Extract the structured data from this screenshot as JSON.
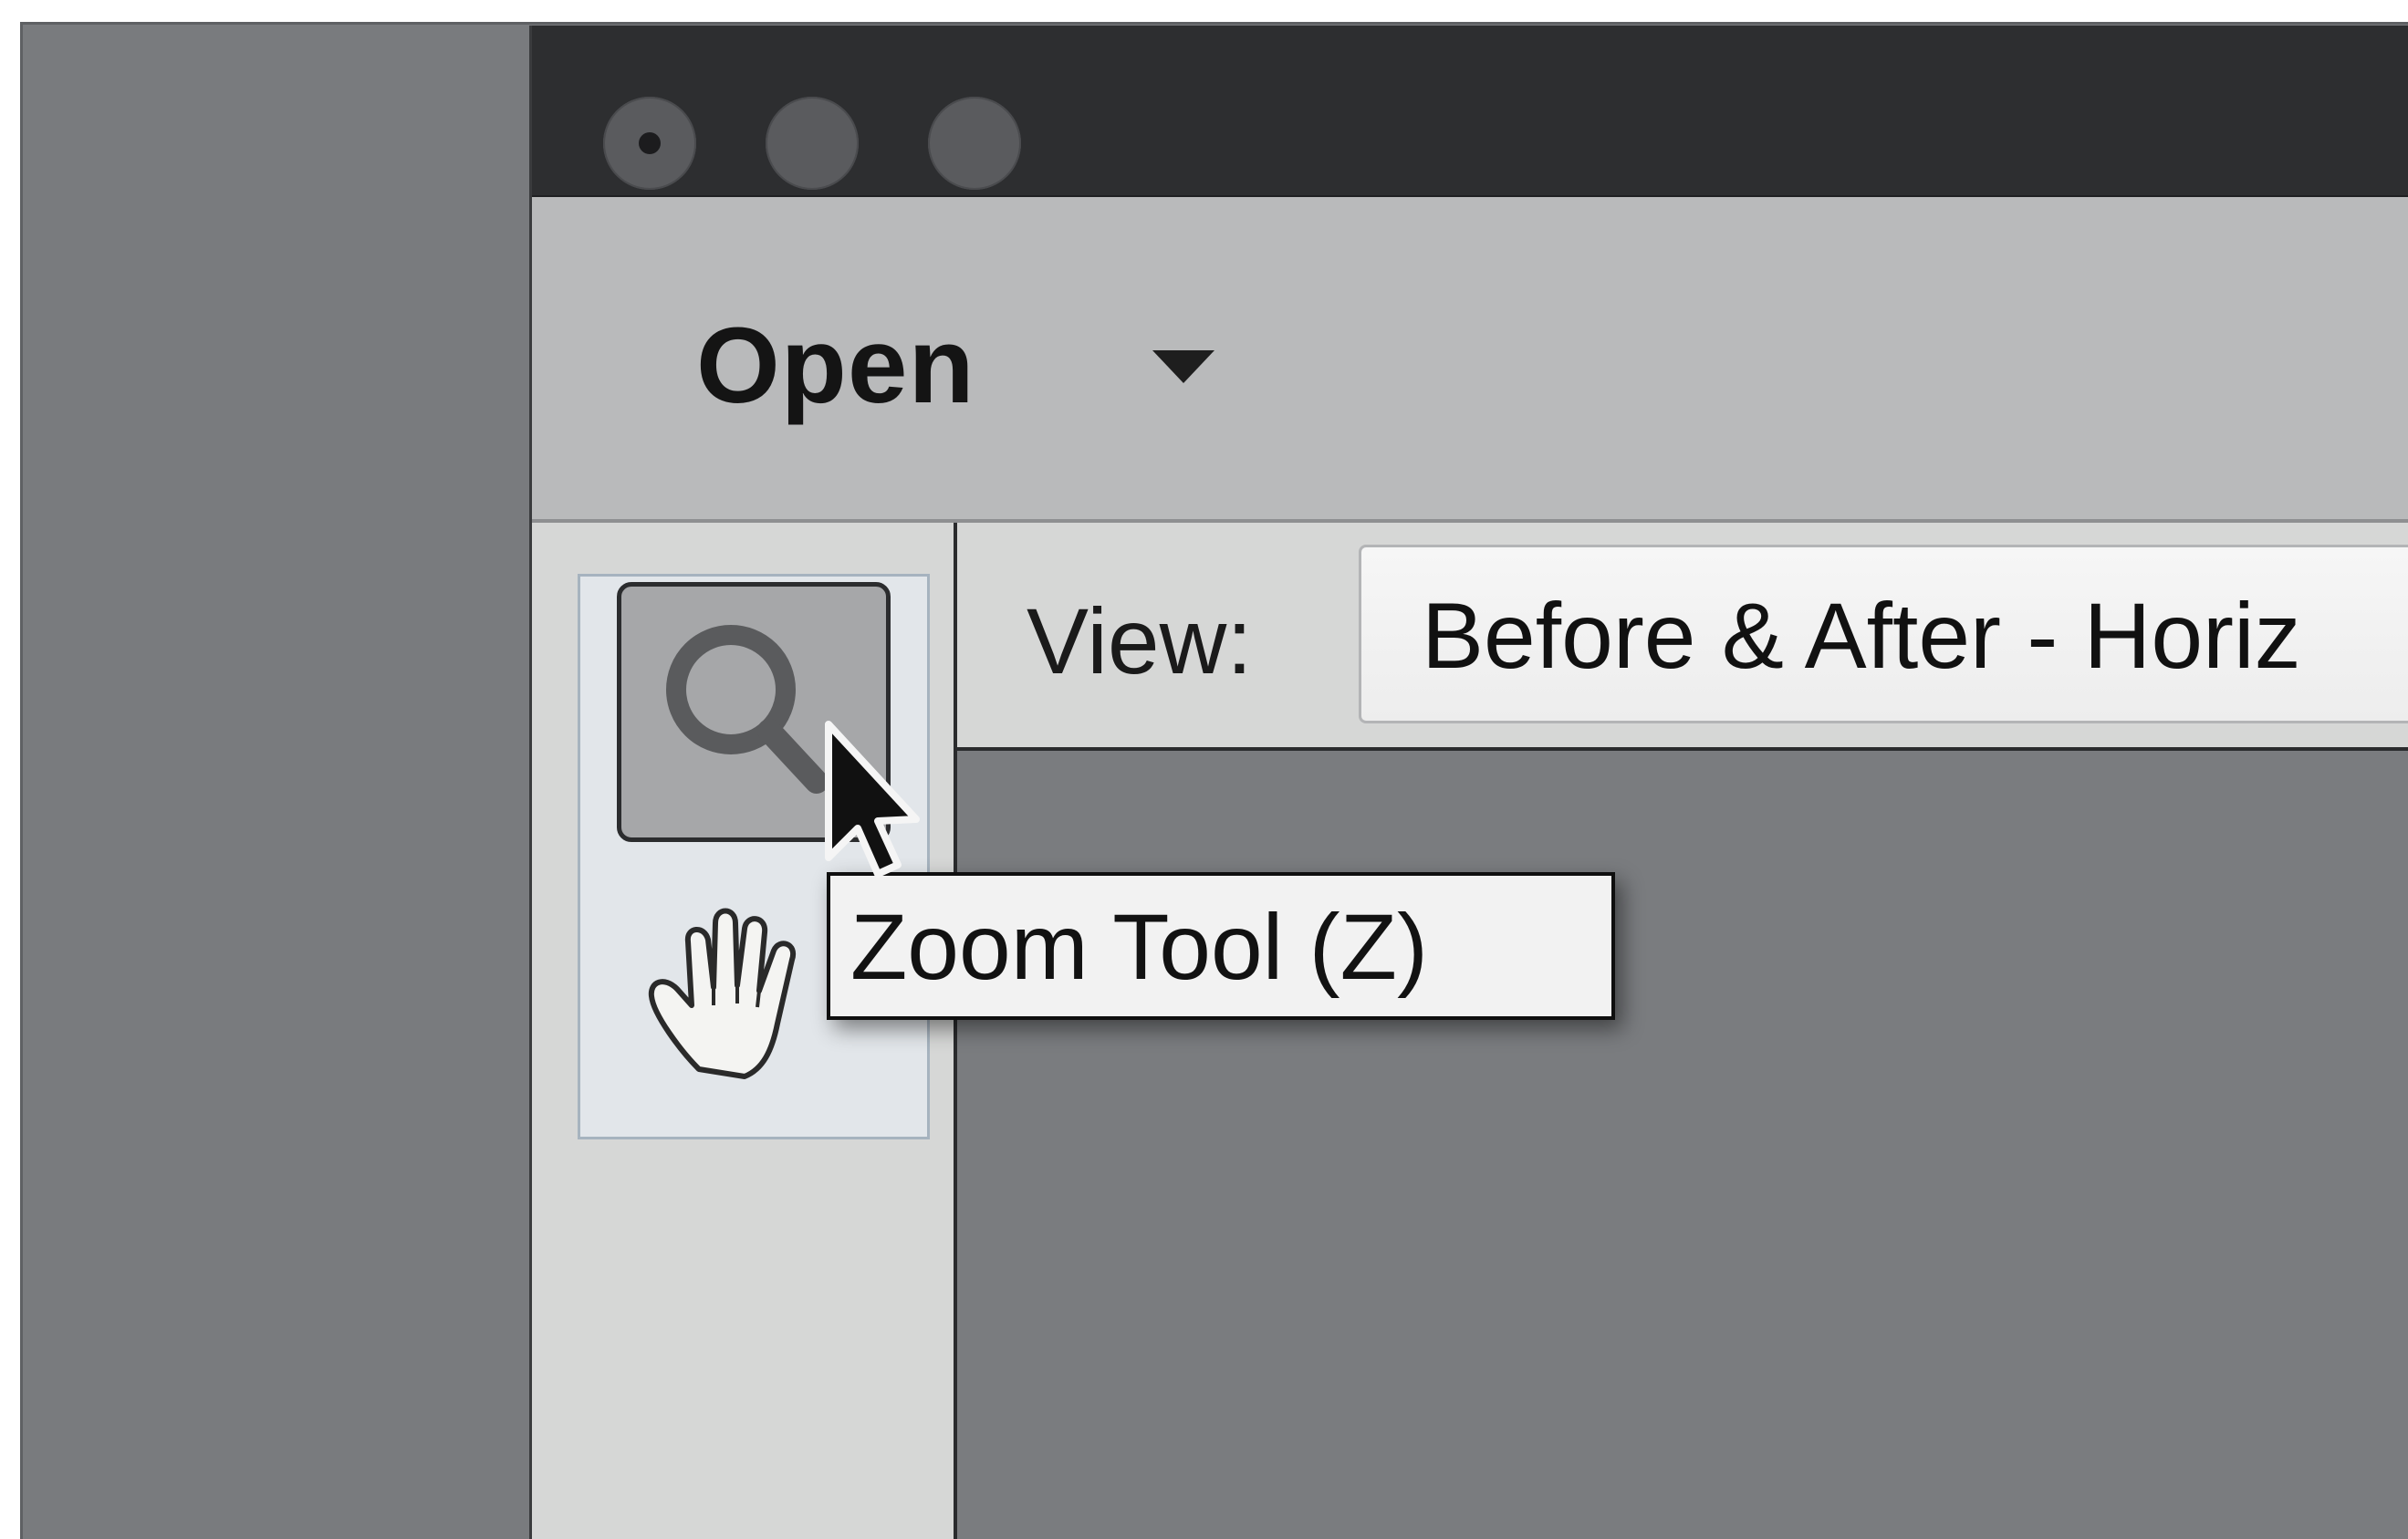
{
  "toolbar": {
    "open_label": "Open",
    "open_dropdown_icon": "caret-down-icon"
  },
  "tools": {
    "zoom_icon": "magnifier-icon",
    "hand_icon": "hand-icon"
  },
  "view_bar": {
    "label": "View:",
    "selected": "Before & After - Horiz"
  },
  "tooltip": {
    "text": "Zoom Tool (Z)"
  },
  "colors": {
    "title_bar": "#2d2e30",
    "toolbar": "#b9babb",
    "panel": "#d6d7d6",
    "canvas": "#7a7c7f",
    "tool_group_highlight": "#e2e6ea"
  }
}
